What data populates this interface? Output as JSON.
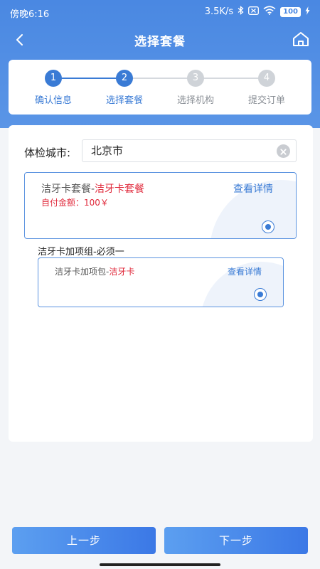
{
  "status_bar": {
    "time": "傍晚6:16",
    "network_speed": "3.5K/s",
    "battery": "100"
  },
  "nav": {
    "title": "选择套餐"
  },
  "steps": [
    {
      "number": "1",
      "label": "确认信息",
      "state": "done"
    },
    {
      "number": "2",
      "label": "选择套餐",
      "state": "active"
    },
    {
      "number": "3",
      "label": "选择机构",
      "state": "todo"
    },
    {
      "number": "4",
      "label": "提交订单",
      "state": "todo"
    }
  ],
  "city": {
    "label": "体检城市:",
    "value": "北京市"
  },
  "package": {
    "prefix": "洁牙卡套餐-",
    "name": "洁牙卡套餐",
    "price_text": "自付金额：100￥",
    "detail_label": "查看详情",
    "selected": true
  },
  "addon_group": {
    "title": "洁牙卡加项组-必须一",
    "item": {
      "prefix": "洁牙卡加项包-",
      "name": "洁牙卡",
      "detail_label": "查看详情",
      "selected": true
    }
  },
  "buttons": {
    "prev_label": "上一步",
    "next_label": "下一步"
  },
  "colors": {
    "primary": "#3a7bd5",
    "header": "#4a88e2",
    "accent_red": "#e0283a",
    "inactive": "#cfd3d8"
  }
}
